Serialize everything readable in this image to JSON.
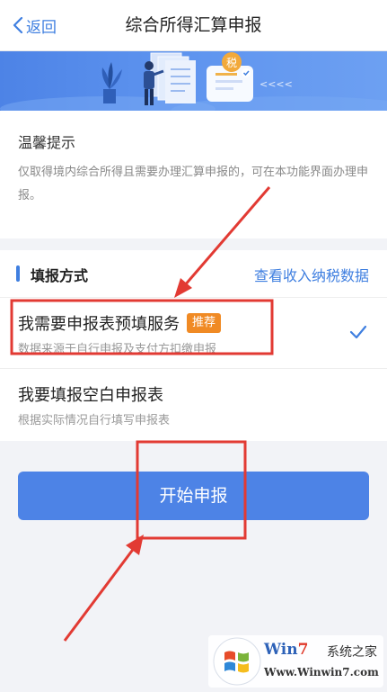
{
  "nav": {
    "back_label": "返回",
    "title": "综合所得汇算申报"
  },
  "banner": {
    "badge_text": "税",
    "arrows_text": "<<<<"
  },
  "tips": {
    "title": "温馨提示",
    "body": "仅取得境内综合所得且需要办理汇算申报的，可在本功能界面办理申报。"
  },
  "method": {
    "section_title": "填报方式",
    "link_text": "查看收入纳税数据",
    "options": [
      {
        "title": "我需要申报表预填服务",
        "badge": "推荐",
        "subtitle": "数据来源于自行申报及支付方扣缴申报",
        "selected": true
      },
      {
        "title": "我要填报空白申报表",
        "subtitle": "根据实际情况自行填写申报表",
        "selected": false
      }
    ]
  },
  "start_button": "开始申报",
  "watermark": {
    "site_prefix": "Win",
    "site_seven": "7",
    "site_suffix": "系统之家",
    "url": "Www.Winwin7.com"
  },
  "colors": {
    "accent": "#3f7fe0",
    "badge": "#f08a24",
    "annotation": "#e23a33"
  }
}
